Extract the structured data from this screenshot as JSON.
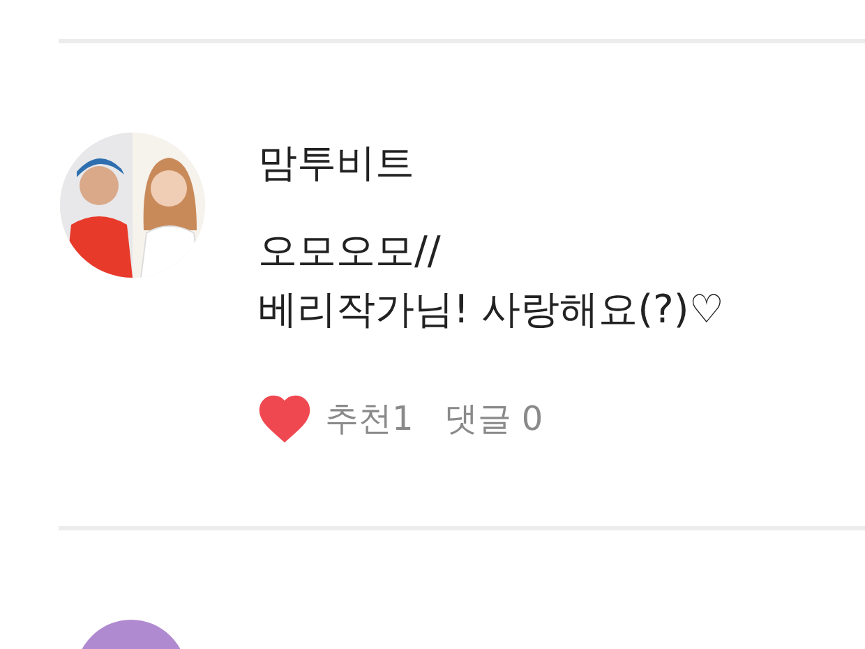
{
  "comments": [
    {
      "author": "맘투비트",
      "lines": [
        "오모오모//",
        "베리작가님! 사랑해요(?)♡"
      ],
      "liked": true,
      "like_label": "추천",
      "like_count": "1",
      "reply_label": "댓글",
      "reply_count": "0"
    }
  ]
}
